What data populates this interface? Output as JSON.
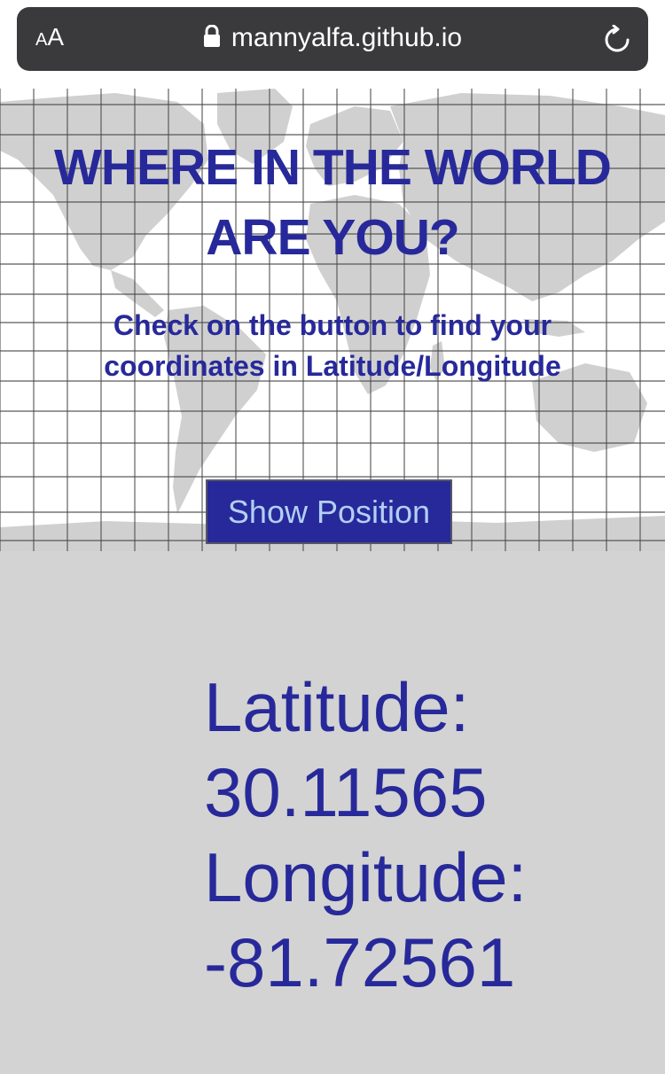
{
  "browser": {
    "text_size_label_small": "A",
    "text_size_label_large": "A",
    "url": "mannyalfa.github.io",
    "icons": [
      "text-size-icon",
      "lock-icon",
      "reload-icon"
    ]
  },
  "hero": {
    "title_line1": "WHERE IN THE WORLD",
    "title_line2": "ARE YOU?",
    "subtitle_line1": "Check on the button to find your",
    "subtitle_line2": "coordinates in Latitude/Longitude",
    "background": "world-map-grid"
  },
  "button": {
    "label": "Show Position"
  },
  "result": {
    "latitude_label": "Latitude:",
    "latitude_value": "30.11565",
    "longitude_label": "Longitude:",
    "longitude_value": "-81.72561"
  },
  "colors": {
    "accent": "#27299a",
    "button_text": "#b3cff5",
    "results_bg": "#d3d3d3",
    "url_bar": "#3a3a3c"
  }
}
